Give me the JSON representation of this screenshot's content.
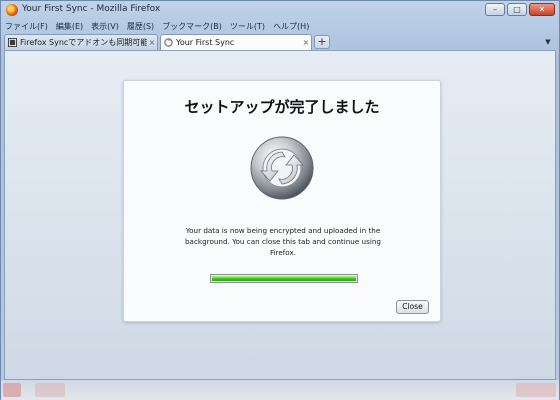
{
  "window": {
    "title": "Your First Sync - Mozilla Firefox"
  },
  "menu": [
    "ファイル(F)",
    "編集(E)",
    "表示(V)",
    "履歴(S)",
    "ブックマーク(B)",
    "ツール(T)",
    "ヘルプ(H)"
  ],
  "tabs": [
    {
      "label": "Firefox Syncでアドオンも同期可能...",
      "close": "×",
      "active": false
    },
    {
      "label": "Your First Sync",
      "close": "×",
      "active": true
    }
  ],
  "new_tab_label": "+",
  "card": {
    "title": "セットアップが完了しました",
    "description": "Your data is now being encrypted and uploaded in the background. You can close this tab and continue using Firefox.",
    "progress": 1.0,
    "close_label": "Close"
  },
  "colors": {
    "progress": "#3ec417",
    "window_frame": "#a9c0dc"
  }
}
